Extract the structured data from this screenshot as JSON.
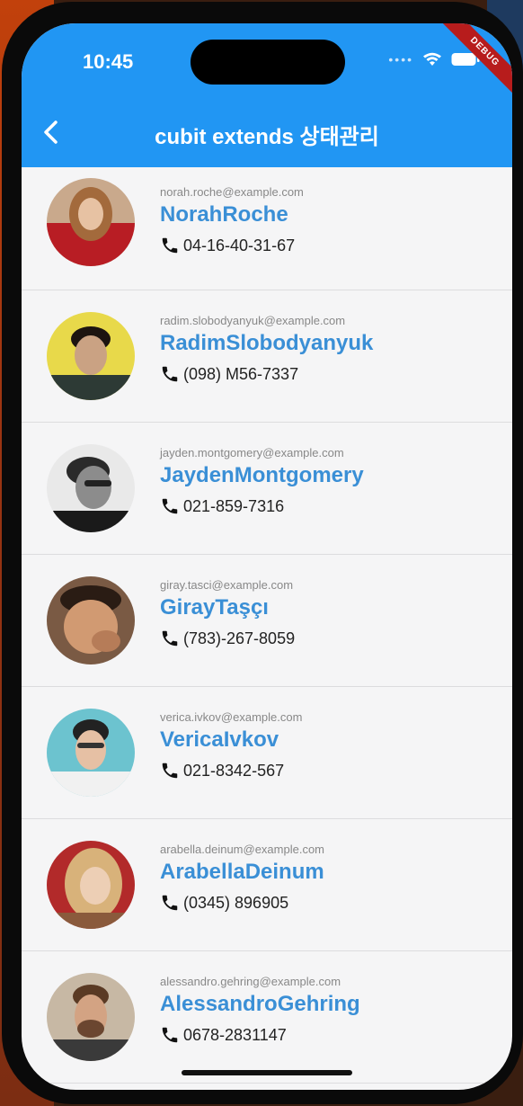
{
  "status": {
    "time": "10:45"
  },
  "debug_label": "DEBUG",
  "appbar": {
    "title": "cubit extends 상태관리"
  },
  "colors": {
    "appbar": "#2196f3",
    "name": "#3a8fd6",
    "debug": "#b71c1c"
  },
  "contacts": [
    {
      "email": "norah.roche@example.com",
      "name": "NorahRoche",
      "phone": "04-16-40-31-67"
    },
    {
      "email": "radim.slobodyanyuk@example.com",
      "name": "RadimSlobodyanyuk",
      "phone": "(098) M56-7337"
    },
    {
      "email": "jayden.montgomery@example.com",
      "name": "JaydenMontgomery",
      "phone": "021-859-7316"
    },
    {
      "email": "giray.tasci@example.com",
      "name": "GirayTaşçı",
      "phone": "(783)-267-8059"
    },
    {
      "email": "verica.ivkov@example.com",
      "name": "VericaIvkov",
      "phone": "021-8342-567"
    },
    {
      "email": "arabella.deinum@example.com",
      "name": "ArabellaDeinum",
      "phone": "(0345) 896905"
    },
    {
      "email": "alessandro.gehring@example.com",
      "name": "AlessandroGehring",
      "phone": "0678-2831147"
    }
  ]
}
